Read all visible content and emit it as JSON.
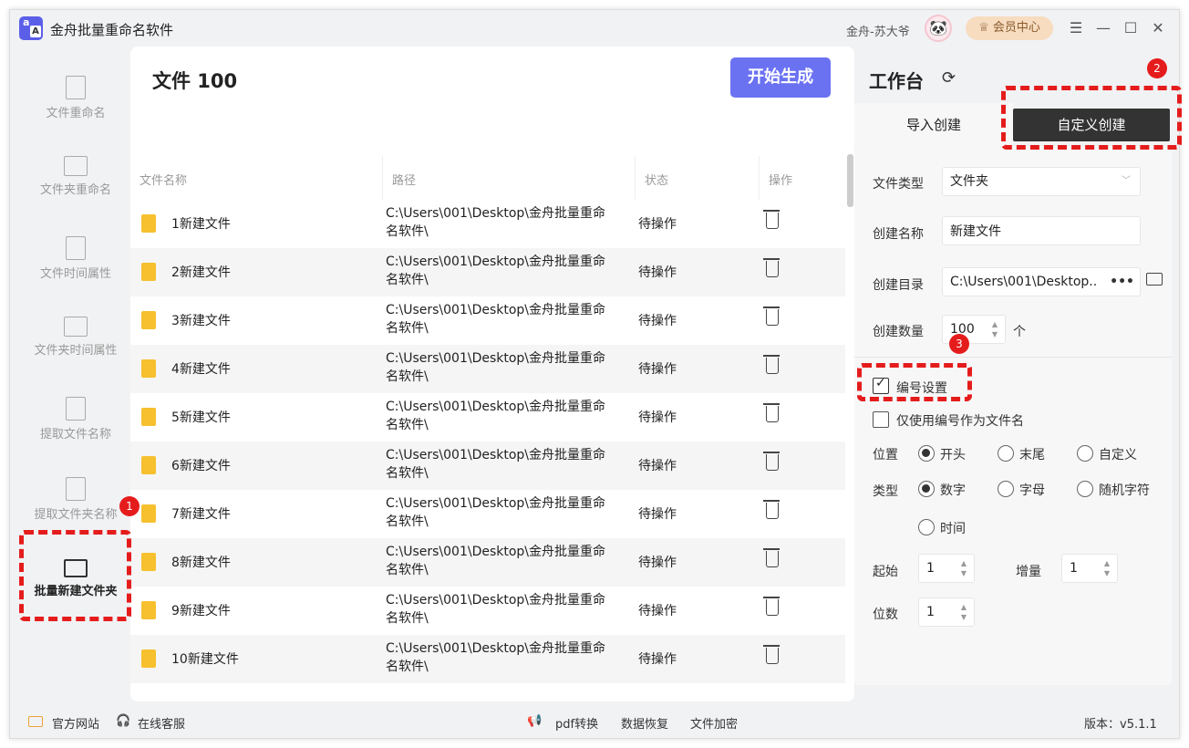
{
  "app": {
    "title": "金舟批量重命名软件",
    "user": "金舟-苏大爷",
    "vip": "会员中心"
  },
  "sidebar": {
    "items": [
      {
        "label": "文件重命名"
      },
      {
        "label": "文件夹重命名"
      },
      {
        "label": "文件时间属性"
      },
      {
        "label": "文件夹时间属性"
      },
      {
        "label": "提取文件名称"
      },
      {
        "label": "提取文件夹名称"
      },
      {
        "label": "批量新建文件夹"
      }
    ]
  },
  "main": {
    "title": "文件 100",
    "start_button": "开始生成",
    "columns": [
      "文件名称",
      "路径",
      "状态",
      "操作"
    ],
    "rows": [
      {
        "name": "1新建文件",
        "path": "C:\\Users\\001\\Desktop\\金舟批量重命名软件\\",
        "status": "待操作"
      },
      {
        "name": "2新建文件",
        "path": "C:\\Users\\001\\Desktop\\金舟批量重命名软件\\",
        "status": "待操作"
      },
      {
        "name": "3新建文件",
        "path": "C:\\Users\\001\\Desktop\\金舟批量重命名软件\\",
        "status": "待操作"
      },
      {
        "name": "4新建文件",
        "path": "C:\\Users\\001\\Desktop\\金舟批量重命名软件\\",
        "status": "待操作"
      },
      {
        "name": "5新建文件",
        "path": "C:\\Users\\001\\Desktop\\金舟批量重命名软件\\",
        "status": "待操作"
      },
      {
        "name": "6新建文件",
        "path": "C:\\Users\\001\\Desktop\\金舟批量重命名软件\\",
        "status": "待操作"
      },
      {
        "name": "7新建文件",
        "path": "C:\\Users\\001\\Desktop\\金舟批量重命名软件\\",
        "status": "待操作"
      },
      {
        "name": "8新建文件",
        "path": "C:\\Users\\001\\Desktop\\金舟批量重命名软件\\",
        "status": "待操作"
      },
      {
        "name": "9新建文件",
        "path": "C:\\Users\\001\\Desktop\\金舟批量重命名软件\\",
        "status": "待操作"
      },
      {
        "name": "10新建文件",
        "path": "C:\\Users\\001\\Desktop\\金舟批量重命名软件\\",
        "status": "待操作"
      }
    ]
  },
  "workbench": {
    "title": "工作台",
    "tab_import": "导入创建",
    "tab_custom": "自定义创建",
    "file_type_label": "文件类型",
    "file_type_value": "文件夹",
    "create_name_label": "创建名称",
    "create_name_value": "新建文件",
    "create_dir_label": "创建目录",
    "create_dir_value": "C:\\Users\\001\\Desktop..",
    "count_label": "创建数量",
    "count_value": "100",
    "count_unit": "个",
    "numbering_label": "编号设置",
    "only_number_label": "仅使用编号作为文件名",
    "position_label": "位置",
    "position_options": [
      "开头",
      "末尾",
      "自定义"
    ],
    "type_label": "类型",
    "type_options": [
      "数字",
      "字母",
      "随机字符",
      "时间"
    ],
    "start_label": "起始",
    "start_value": "1",
    "step_label": "增量",
    "step_value": "1",
    "digits_label": "位数",
    "digits_value": "1"
  },
  "badges": [
    "1",
    "2",
    "3"
  ],
  "footer": {
    "website": "官方网站",
    "support": "在线客服",
    "pdf": "pdf转换",
    "recover": "数据恢复",
    "encrypt": "文件加密",
    "version": "版本：v5.1.1"
  },
  "colors": {
    "accent": "#6b72f2",
    "highlight": "#e51c1c",
    "folder": "#f6c02e"
  }
}
